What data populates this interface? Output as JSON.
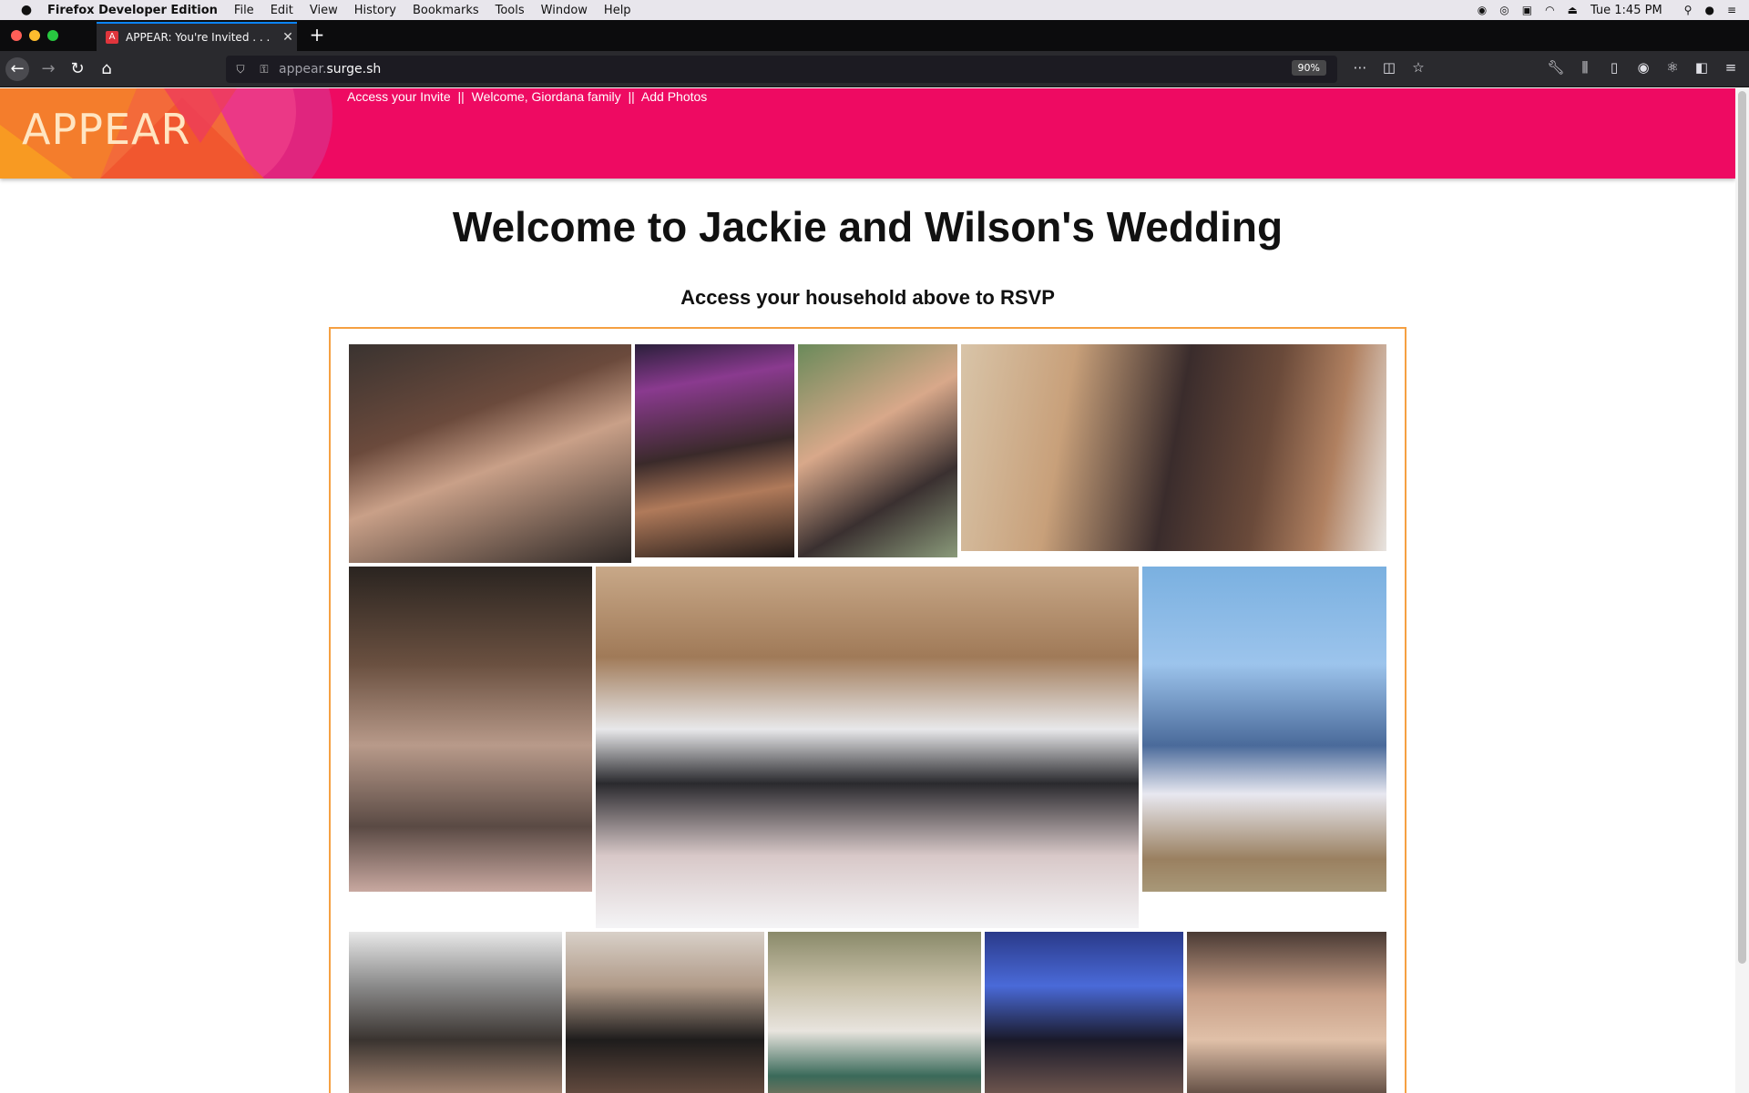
{
  "menubar": {
    "app_name": "Firefox Developer Edition",
    "items": [
      "File",
      "Edit",
      "View",
      "History",
      "Bookmarks",
      "Tools",
      "Window",
      "Help"
    ],
    "clock": "Tue 1:45 PM"
  },
  "browser": {
    "tab_title": "APPEAR: You're Invited . . .",
    "tab_favicon": "A",
    "url_prefix": "appear.",
    "url_domain": "surge.sh",
    "zoom": "90%"
  },
  "site": {
    "logo": "APPEAR",
    "nav": {
      "access_invite": "Access your Invite",
      "welcome_family": "Welcome, Giordana family",
      "add_photos": "Add Photos",
      "separator": "||"
    },
    "heading": "Welcome to Jackie and Wilson's Wedding",
    "subheading": "Access your household above to RSVP"
  },
  "colors": {
    "header_pink": "#ee0a62",
    "logo_text": "#ffe5c2",
    "gallery_border": "#f5a042",
    "tab_accent": "#0a84ff"
  }
}
